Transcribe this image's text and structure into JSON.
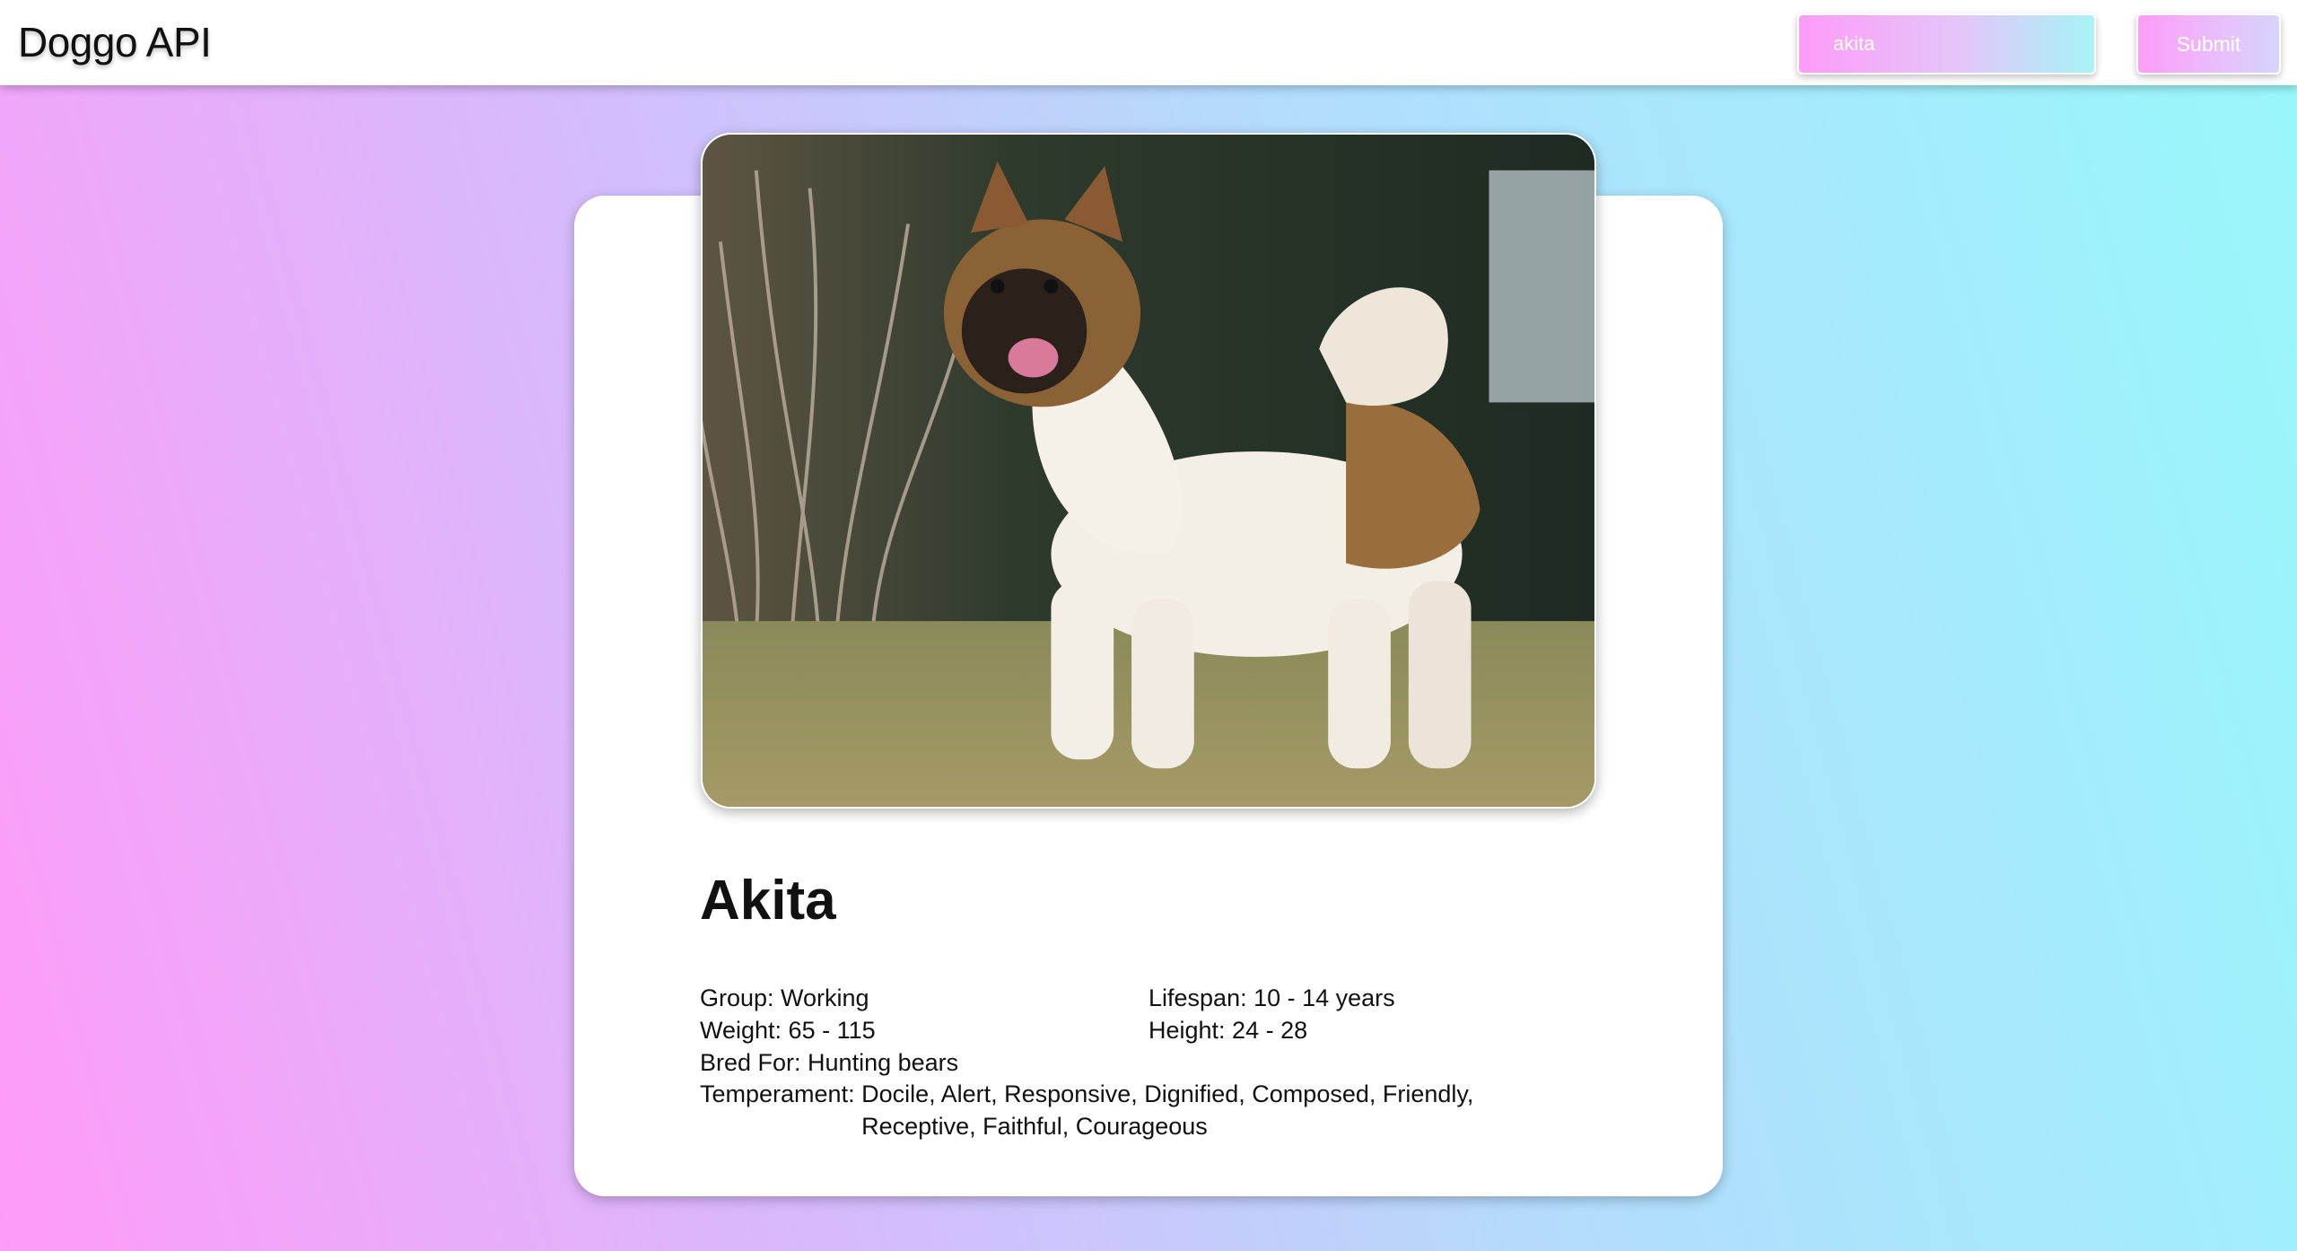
{
  "app": {
    "title": "Doggo API"
  },
  "search": {
    "value": "akita",
    "submit_label": "Submit"
  },
  "breed": {
    "name": "Akita",
    "group": "Group: Working",
    "lifespan": "Lifespan: 10 - 14 years",
    "weight": "Weight: 65 - 115",
    "height": "Height: 24 - 28",
    "bred_for": "Bred For: Hunting bears",
    "temperament_label": "Temperament:",
    "temperament": "Docile, Alert, Responsive, Dignified, Composed, Friendly, Receptive, Faithful, Courageous"
  },
  "image": {
    "subject": "dog-photo"
  },
  "colors": {
    "gradient_pink": "#ff9bf9",
    "gradient_cyan": "#98f8fb",
    "card": "#ffffff"
  }
}
